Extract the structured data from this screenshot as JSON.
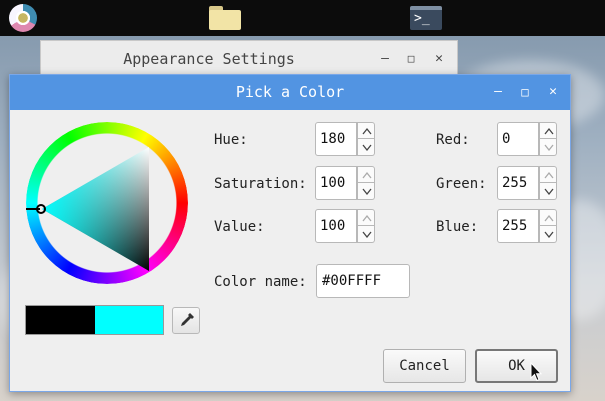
{
  "desktop": {
    "taskbar_icons": [
      "chromium-icon",
      "folder-icon",
      "terminal-icon"
    ],
    "terminal_glyph": ">_"
  },
  "background_window": {
    "title": "Appearance Settings",
    "controls": {
      "minimize": "–",
      "maximize": "□",
      "close": "✕"
    }
  },
  "dialog": {
    "title": "Pick a Color",
    "title_bar_color": "#5294e2",
    "controls": {
      "minimize": "–",
      "maximize": "□",
      "close": "✕"
    },
    "hsv": {
      "hue_label": "Hue:",
      "hue": "180",
      "saturation_label": "Saturation:",
      "saturation": "100",
      "value_label": "Value:",
      "value": "100"
    },
    "rgb": {
      "red_label": "Red:",
      "red": "0",
      "green_label": "Green:",
      "green": "255",
      "blue_label": "Blue:",
      "blue": "255"
    },
    "color_name_label": "Color name:",
    "color_name": "#00FFFF",
    "preview": {
      "old_color": "#000000",
      "new_color": "#00ffff"
    },
    "cancel_label": "Cancel",
    "ok_label": "OK"
  }
}
